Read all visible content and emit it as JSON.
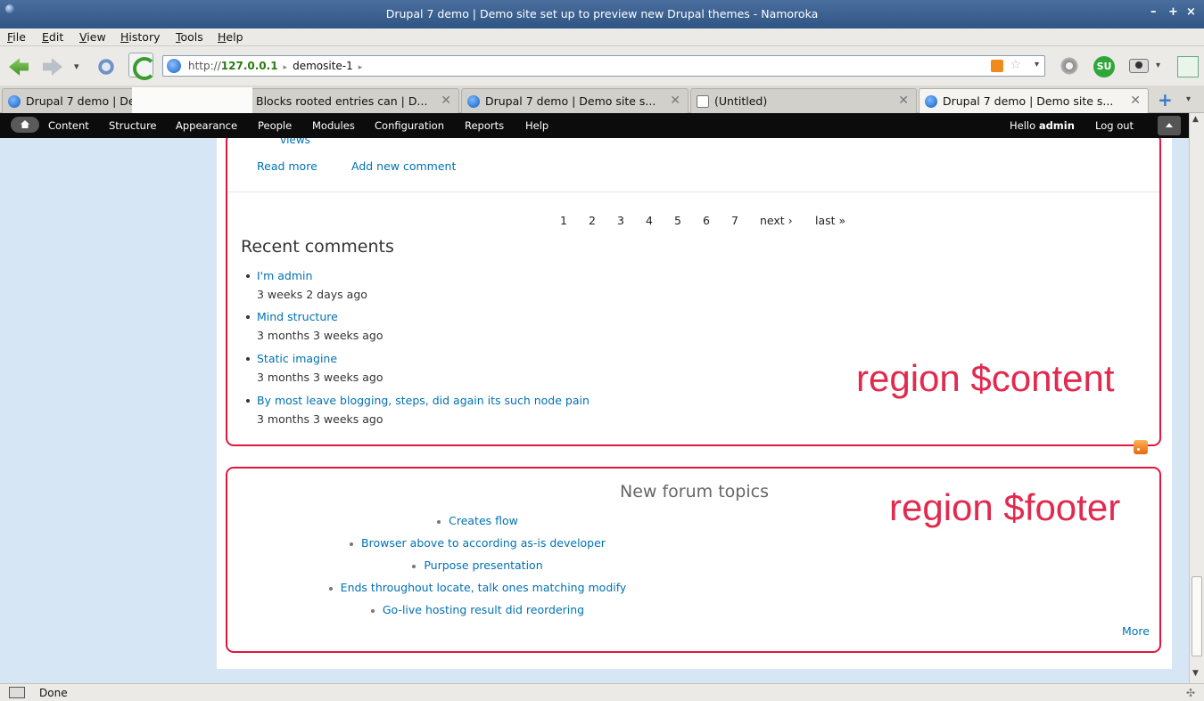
{
  "window": {
    "title": "Drupal 7 demo | Demo site set up to preview new Drupal themes - Namoroka",
    "minimize": "–",
    "maximize": "+",
    "close": "×"
  },
  "menu": [
    "File",
    "Edit",
    "View",
    "History",
    "Tools",
    "Help"
  ],
  "urlbar": {
    "prefix": "http://",
    "host": "127.0.0.1",
    "path": "demosite-1",
    "sep": "▸"
  },
  "tabs": [
    {
      "label": "Drupal 7 demo | De",
      "close": ""
    },
    {
      "label": "Blocks rooted entries can | D...",
      "close": "✕"
    },
    {
      "label": "Drupal 7 demo | Demo site s...",
      "close": "✕"
    },
    {
      "label": "(Untitled)",
      "close": "✕"
    },
    {
      "label": "Drupal 7 demo | Demo site s...",
      "close": "✕"
    }
  ],
  "toolbar_icons": {
    "stumble": "SU",
    "new_tab": "+",
    "dropdown": "▾"
  },
  "admin": {
    "items": [
      "Content",
      "Structure",
      "Appearance",
      "People",
      "Modules",
      "Configuration",
      "Reports",
      "Help"
    ],
    "hello_prefix": "Hello ",
    "user": "admin",
    "logout": "Log out"
  },
  "content": {
    "views_fragment": "views",
    "read_more": "Read more",
    "add_comment": "Add new comment",
    "pager": [
      "1",
      "2",
      "3",
      "4",
      "5",
      "6",
      "7",
      "next ›",
      "last »"
    ],
    "recent_title": "Recent comments",
    "comments": [
      {
        "title": "I'm admin",
        "time": "3 weeks 2 days ago"
      },
      {
        "title": "Mind structure",
        "time": "3 months 3 weeks ago"
      },
      {
        "title": "Static imagine",
        "time": "3 months 3 weeks ago"
      },
      {
        "title": "By most leave blogging, steps, did again its such node pain",
        "time": "3 months 3 weeks ago"
      }
    ],
    "region_label": "region $content"
  },
  "footer": {
    "title": "New forum topics",
    "topics": [
      "Creates flow",
      "Browser above to according as-is developer",
      "Purpose presentation",
      "Ends throughout locate, talk ones matching modify",
      "Go-live hosting result did reordering"
    ],
    "more": "More",
    "region_label": "region $footer"
  },
  "status": {
    "text": "Done"
  },
  "colors": {
    "link": "#0071b3",
    "region": "#e2163e",
    "admin_bar": "#0c0c0c",
    "page_bg": "#d6e6f5"
  }
}
